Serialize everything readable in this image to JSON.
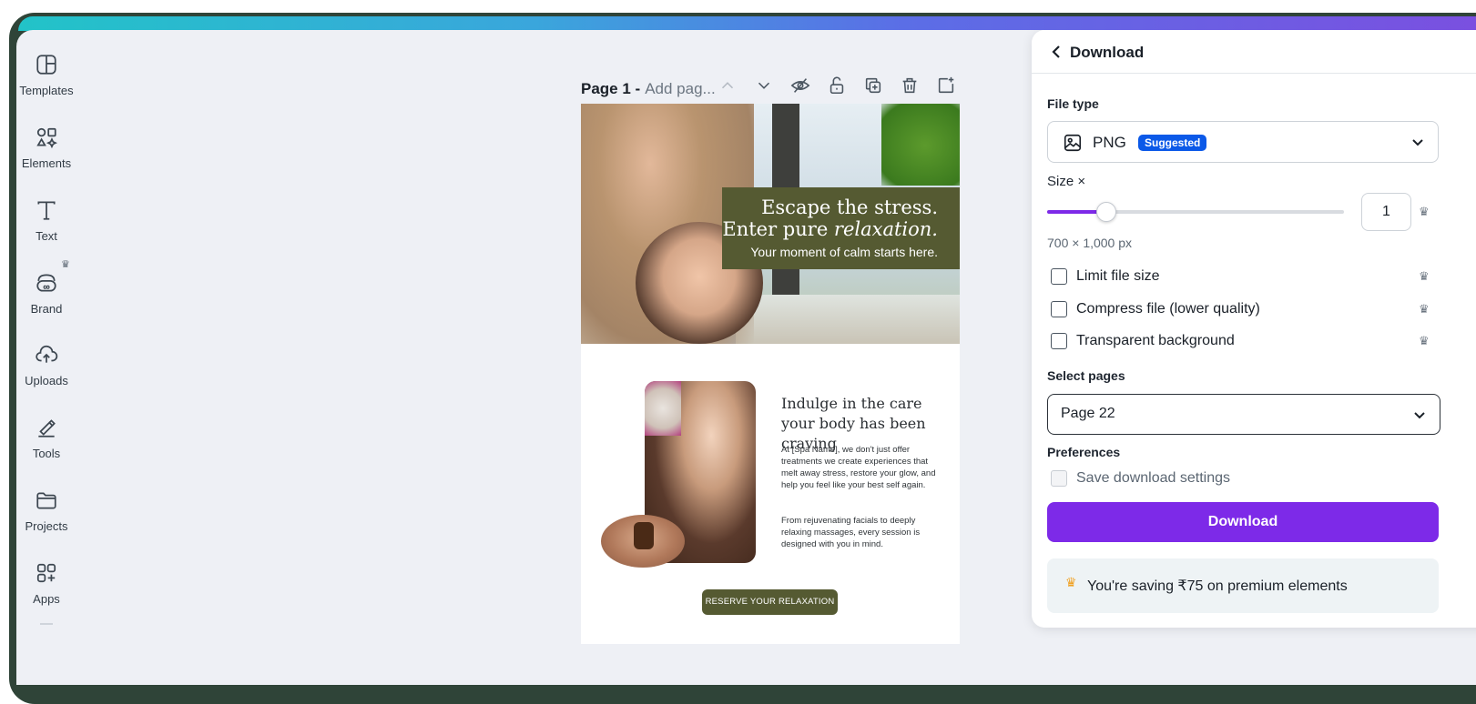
{
  "sidebar": {
    "items": [
      {
        "label": "Templates",
        "icon": "templates-icon"
      },
      {
        "label": "Elements",
        "icon": "elements-icon"
      },
      {
        "label": "Text",
        "icon": "text-icon"
      },
      {
        "label": "Brand",
        "icon": "brand-icon"
      },
      {
        "label": "Uploads",
        "icon": "uploads-icon"
      },
      {
        "label": "Tools",
        "icon": "tools-icon"
      },
      {
        "label": "Projects",
        "icon": "projects-icon"
      },
      {
        "label": "Apps",
        "icon": "apps-icon"
      }
    ]
  },
  "page_header": {
    "title": "Page 1 -",
    "subtitle": "Add pag..."
  },
  "canvas": {
    "banner": {
      "line1": "Escape the stress.",
      "line2_plain": "Enter pure ",
      "line2_italic": "relaxation.",
      "line3": "Your moment of calm starts here."
    },
    "intro_heading": "Indulge in the care your body has been craving",
    "paragraph1": "At [Spa Name], we don't just offer treatments we create experiences that melt away stress, restore your glow, and help you feel like your best self again.",
    "paragraph2": "From rejuvenating facials to deeply relaxing massages, every session is designed with you in mind.",
    "cta": "RESERVE YOUR RELAXATION"
  },
  "download_panel": {
    "title": "Download",
    "file_type_label": "File type",
    "file_type_value": "PNG",
    "suggested_badge": "Suggested",
    "size_label": "Size ×",
    "size_value": "1",
    "size_slider_fraction": 0.2,
    "dimensions": "700 × 1,000 px",
    "options": [
      {
        "label": "Limit file size",
        "checked": false,
        "premium": true
      },
      {
        "label": "Compress file (lower quality)",
        "checked": false,
        "premium": true
      },
      {
        "label": "Transparent background",
        "checked": false,
        "premium": true
      }
    ],
    "select_pages_label": "Select pages",
    "select_pages_value": "Page 22",
    "preferences_label": "Preferences",
    "save_settings_label": "Save download settings",
    "download_button": "Download",
    "saving_text": "You're saving ₹75 on premium elements"
  },
  "colors": {
    "accent_purple": "#7d2ae8",
    "badge_blue": "#0b59e8",
    "banner_olive": "#555a32"
  }
}
